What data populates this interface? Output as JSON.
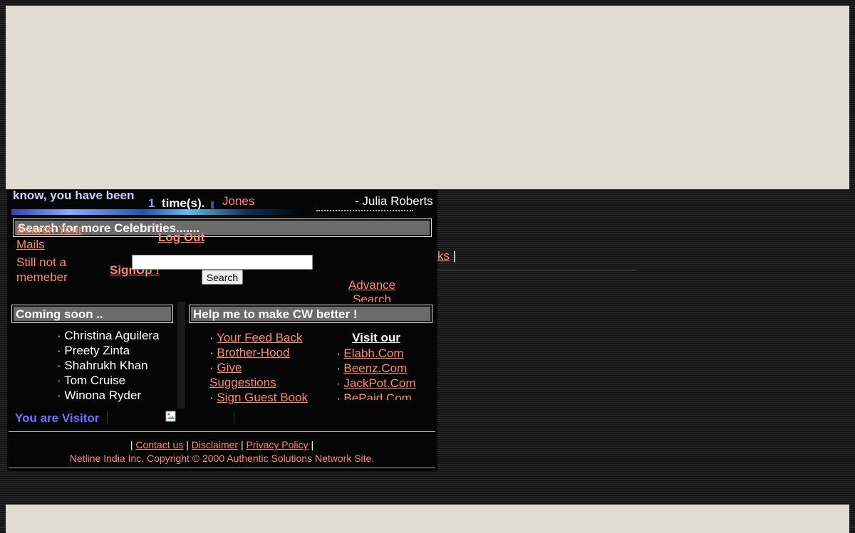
{
  "peek": {
    "visit_text_line1": "know, you have been",
    "visit_count": "1",
    "visit_suffix": "time(s).",
    "jones_link": "Jones",
    "julia": "- Julia Roberts"
  },
  "search": {
    "title": "Search for more Celebrities.......",
    "mails_link_line1": "Search Your",
    "mails_link_line2": "Mails",
    "logout": "Log Out",
    "not_member_line1": "Still not a",
    "not_member_line2": "memeber",
    "signup": "SignUp !",
    "input_value": "",
    "button": "Search",
    "advance_line1": "Advance",
    "advance_line2": "Search"
  },
  "side_nav": {
    "partial_link": "ks",
    "separator": "|"
  },
  "coming_soon": {
    "title": "Coming soon ..",
    "items": [
      "Christina Aguilera",
      "Preety Zinta",
      "Shahrukh Khan",
      "Tom Cruise",
      "Winona Ryder"
    ]
  },
  "help": {
    "title": "Help me to make CW better !",
    "links": [
      "Your Feed Back",
      "Brother-Hood",
      "Give",
      "Suggestions",
      "Sign Guest Book"
    ],
    "visit_title": "Visit our",
    "sites": [
      "Elabh.Com",
      "Beenz.Com",
      "JackPot.Com",
      "BePaid.Com"
    ]
  },
  "visitor": {
    "label": "You are Visitor"
  },
  "footer": {
    "links": [
      "Contact us",
      "Disclaimer",
      "Privacy Policy"
    ],
    "separator": "|",
    "copyright": "Netline India Inc. Copyright © 2000 Authentic Solutions Network Site."
  },
  "colors": {
    "link": "#ff8a65",
    "banner": "#dfdbd0",
    "header_bar": "#6b6b6b",
    "visitor": "#6f6fff"
  },
  "icons": {
    "broken_image": "broken-image-icon"
  }
}
